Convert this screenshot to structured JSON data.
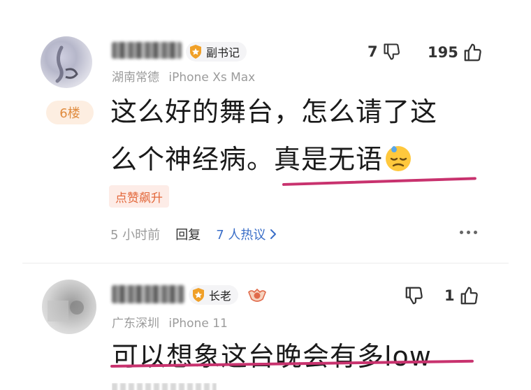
{
  "comments": [
    {
      "rank": "副书记",
      "location": "湖南常德",
      "device": "iPhone Xs Max",
      "dislike_count": "7",
      "like_count": "195",
      "floor": "6楼",
      "text_line1": "这么好的舞台，怎么请了这",
      "text_line2_a": "么个神经病。",
      "text_line2_b": "真是无语",
      "emoji": "downcast-sweat-emoji",
      "tag": "点赞飙升",
      "time": "5 小时前",
      "reply_label": "回复",
      "thread_label": "7 人热议",
      "more_icon": "more-dots-icon"
    },
    {
      "rank": "长老",
      "location": "广东深圳",
      "device": "iPhone 11",
      "dislike_count": "",
      "like_count": "1",
      "text_line1": "可以想象这台晚会有多low"
    }
  ],
  "colors": {
    "underline": "#c8326e",
    "rank_shield": "#f0a028",
    "floor_bg": "#fdeee1",
    "floor_text": "#e08b3e",
    "tag_bg": "#fdece7",
    "tag_text": "#e3683b",
    "link": "#3a6ec8"
  }
}
